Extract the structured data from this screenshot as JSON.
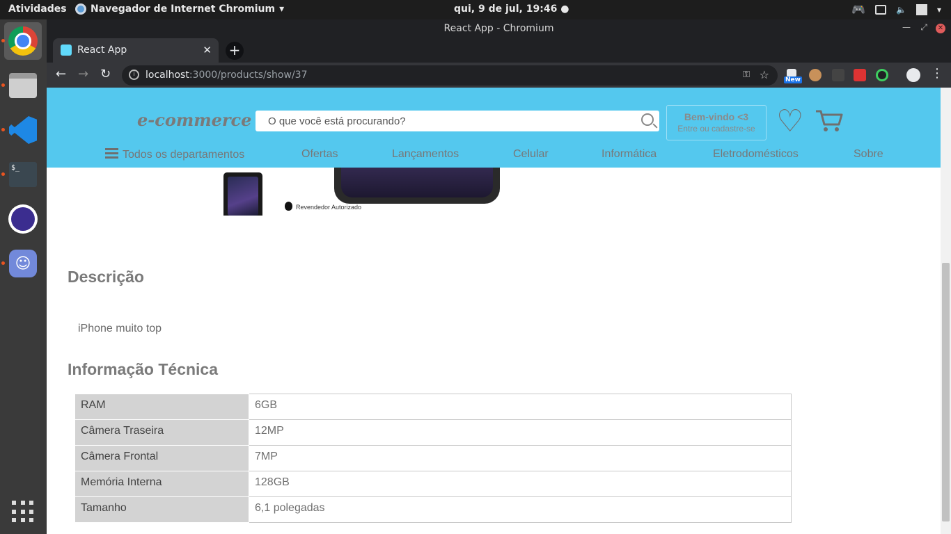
{
  "os": {
    "activities": "Atividades",
    "app_menu": "Navegador de Internet Chromium",
    "clock": "qui,  9 de jul, 19:46"
  },
  "browser": {
    "window_title": "React App - Chromium",
    "tab_title": "React App",
    "url_host": "localhost",
    "url_rest": ":3000/products/show/37",
    "ext_badge": "New"
  },
  "site": {
    "logo": "e-commerce",
    "search_placeholder": "O que você está procurando?",
    "welcome_title": "Bem-vindo <3",
    "welcome_sub": "Entre ou cadastre-se",
    "nav": [
      {
        "label": "Todos os departamentos"
      },
      {
        "label": "Ofertas"
      },
      {
        "label": "Lançamentos"
      },
      {
        "label": "Celular"
      },
      {
        "label": "Informática"
      },
      {
        "label": "Eletrodomésticos"
      },
      {
        "label": "Sobre"
      }
    ]
  },
  "product": {
    "reseller_label": "Revendedor Autorizado",
    "description_title": "Descrição",
    "description_text": "iPhone muito top",
    "tech_title": "Informação Técnica",
    "specs": [
      {
        "name": "RAM",
        "value": "6GB"
      },
      {
        "name": "Câmera Traseira",
        "value": "12MP"
      },
      {
        "name": "Câmera Frontal",
        "value": "7MP"
      },
      {
        "name": "Memória Interna",
        "value": "128GB"
      },
      {
        "name": "Tamanho",
        "value": "6,1 polegadas"
      }
    ]
  },
  "colors": {
    "header_bg": "#54c8ee",
    "text_gray": "#7a7a7a"
  }
}
